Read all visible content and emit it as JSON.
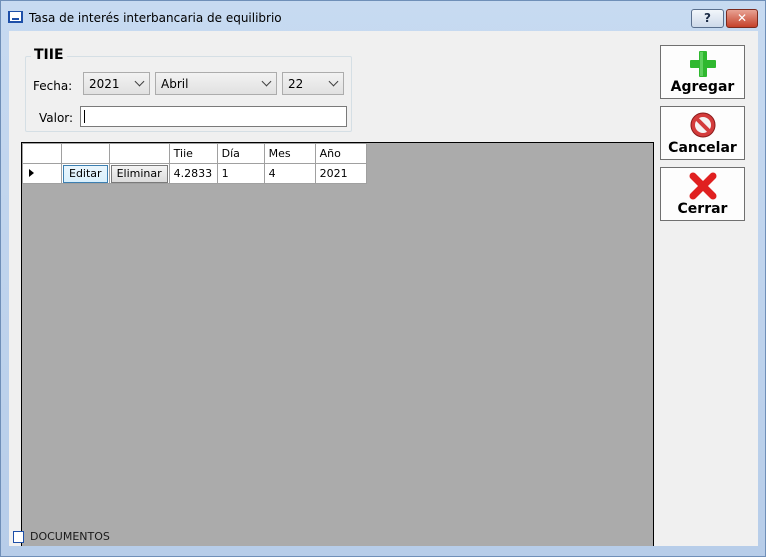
{
  "window": {
    "title": "Tasa de interés interbancaria de equilibrio",
    "help_label": "?",
    "close_label": "✕"
  },
  "group": {
    "legend": "TIIE",
    "fecha_label": "Fecha:",
    "valor_label": "Valor:",
    "year_value": "2021",
    "month_value": "Abril",
    "day_value": "22",
    "valor_value": ""
  },
  "actions": {
    "agregar": "Agregar",
    "cancelar": "Cancelar",
    "cerrar": "Cerrar"
  },
  "grid": {
    "columns": [
      "",
      "",
      "Tiie",
      "Día",
      "Mes",
      "Año"
    ],
    "rows": [
      {
        "edit_label": "Editar",
        "delete_label": "Eliminar",
        "tiie": "4.2833",
        "dia": "1",
        "mes": "4",
        "anio": "2021"
      }
    ]
  },
  "footer": {
    "text": "DOCUMENTOS"
  },
  "colors": {
    "agregar_icon": "#2fb82f",
    "cancelar_icon": "#d43c3c",
    "cerrar_icon": "#e02020",
    "grid_background": "#ababab"
  },
  "icons": {
    "agregar": "plus-icon",
    "cancelar": "no-entry-icon",
    "cerrar": "x-icon"
  }
}
